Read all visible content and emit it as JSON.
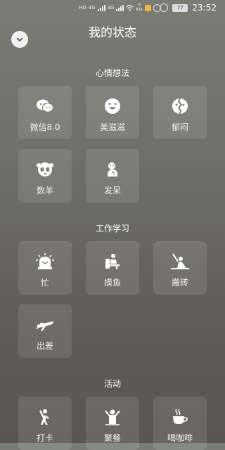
{
  "status": {
    "time": "23:52",
    "net_rate": "0",
    "net_unit": "K/s",
    "battery": "77",
    "hd": "HD",
    "sim1": "4G",
    "sim2": "4G"
  },
  "header": {
    "title": "我的状态"
  },
  "sections": [
    {
      "title": "心情想法",
      "items": [
        {
          "label": "微信8.0",
          "icon": "wechat-icon"
        },
        {
          "label": "美滋滋",
          "icon": "smile-icon"
        },
        {
          "label": "郁闷",
          "icon": "gloomy-icon"
        },
        {
          "label": "数羊",
          "icon": "sheep-icon"
        },
        {
          "label": "发呆",
          "icon": "daze-icon"
        }
      ]
    },
    {
      "title": "工作学习",
      "items": [
        {
          "label": "忙",
          "icon": "busy-alarm-icon"
        },
        {
          "label": "摸鱼",
          "icon": "slacking-icon"
        },
        {
          "label": "搬砖",
          "icon": "brick-icon"
        },
        {
          "label": "出差",
          "icon": "plane-icon"
        }
      ]
    },
    {
      "title": "活动",
      "items": [
        {
          "label": "打卡",
          "icon": "check-in-icon"
        },
        {
          "label": "聚餐",
          "icon": "dinner-icon"
        },
        {
          "label": "喝咖啡",
          "icon": "coffee-icon"
        }
      ]
    }
  ]
}
